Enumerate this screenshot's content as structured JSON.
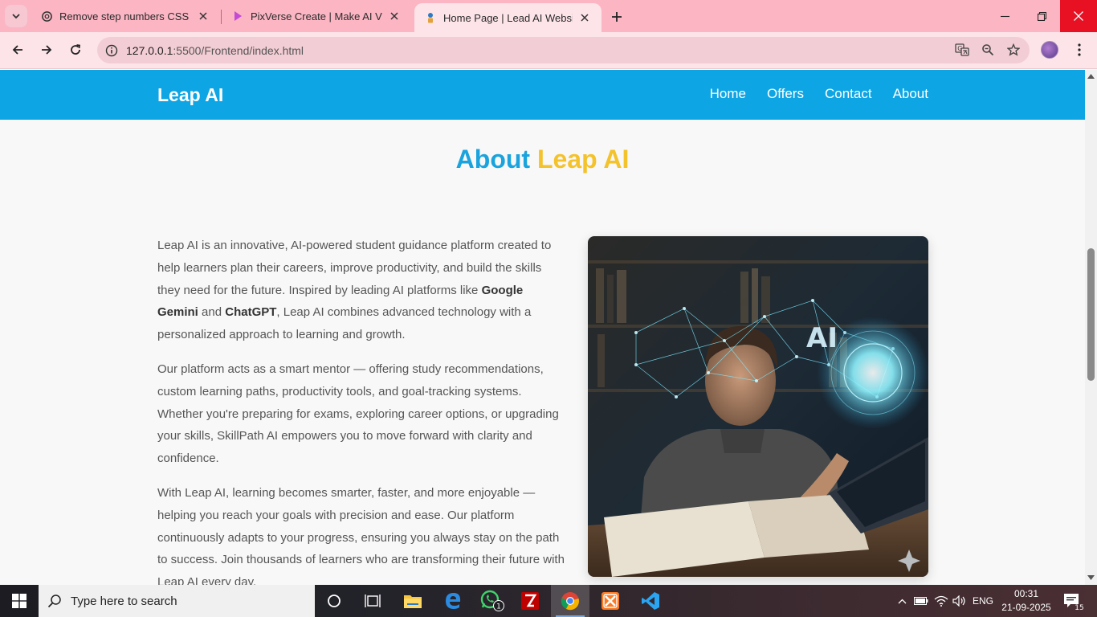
{
  "browser": {
    "tabs": [
      {
        "title": "Remove step numbers CSS",
        "favicon": "chatgpt-icon"
      },
      {
        "title": "PixVerse Create | Make AI Videos",
        "favicon": "pixverse-icon"
      },
      {
        "title": "Home Page | Lead AI Website",
        "favicon": "site-icon",
        "active": true
      }
    ],
    "url_host": "127.0.0.1",
    "url_path": ":5500/Frontend/index.html",
    "accent": "#fbb5c3"
  },
  "site": {
    "brand": "Leap AI",
    "nav": [
      "Home",
      "Offers",
      "Contact",
      "About"
    ],
    "heading_part1": "About",
    "heading_part2": "Leap AI",
    "paragraphs": [
      {
        "a": "Leap AI is an innovative, AI-powered student guidance platform created to help learners plan their careers, improve productivity, and build the skills they need for the future. Inspired by leading AI platforms like ",
        "b1": "Google Gemini",
        "c": " and ",
        "b2": "ChatGPT",
        "d": ", Leap AI combines advanced technology with a personalized approach to learning and growth."
      },
      "Our platform acts as a smart mentor — offering study recommendations, custom learning paths, productivity tools, and goal-tracking systems. Whether you're preparing for exams, exploring career options, or upgrading your skills, SkillPath AI empowers you to move forward with clarity and confidence.",
      "With Leap AI, learning becomes smarter, faster, and more enjoyable — helping you reach your goals with precision and ease. Our platform continuously adapts to your progress, ensuring you always stay on the path to success. Join thousands of learners who are transforming their future with Leap AI every day."
    ],
    "image_text": "AI",
    "colors": {
      "navbar": "#0ea5e4",
      "heading_blue": "#1aa3dc",
      "heading_yellow": "#f4c22a"
    }
  },
  "taskbar": {
    "search_placeholder": "Type here to search",
    "whatsapp_badge": "1",
    "language": "ENG",
    "time": "00:31",
    "date": "21-09-2025",
    "notifications": "15"
  }
}
